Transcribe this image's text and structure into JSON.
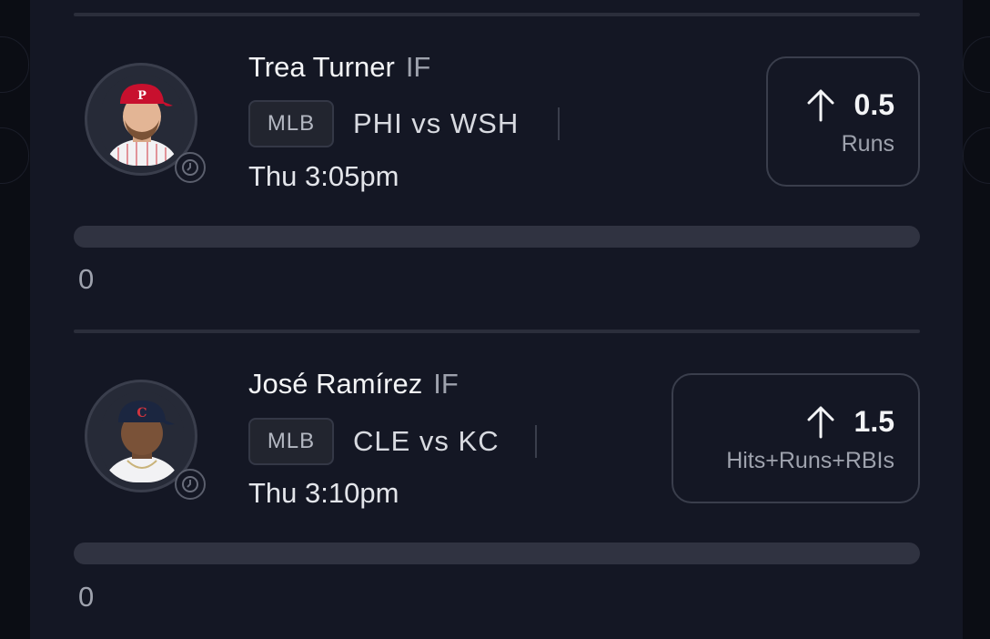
{
  "picks": [
    {
      "player_name": "Trea Turner",
      "position": "IF",
      "league": "MLB",
      "matchup": "PHI vs WSH",
      "game_time": "Thu 3:05pm",
      "direction_icon": "arrow-up-icon",
      "line": "0.5",
      "stat": "Runs",
      "progress_text": "0",
      "progress_fraction": 0,
      "cap_color": "#c8102e",
      "jersey_color": "#f2f2f4"
    },
    {
      "player_name": "José Ramírez",
      "position": "IF",
      "league": "MLB",
      "matchup": "CLE vs KC",
      "game_time": "Thu 3:10pm",
      "direction_icon": "arrow-up-icon",
      "line": "1.5",
      "stat": "Hits+Runs+RBIs",
      "progress_text": "0",
      "progress_fraction": 0,
      "cap_color": "#1b2640",
      "jersey_color": "#f2f2f4"
    }
  ]
}
